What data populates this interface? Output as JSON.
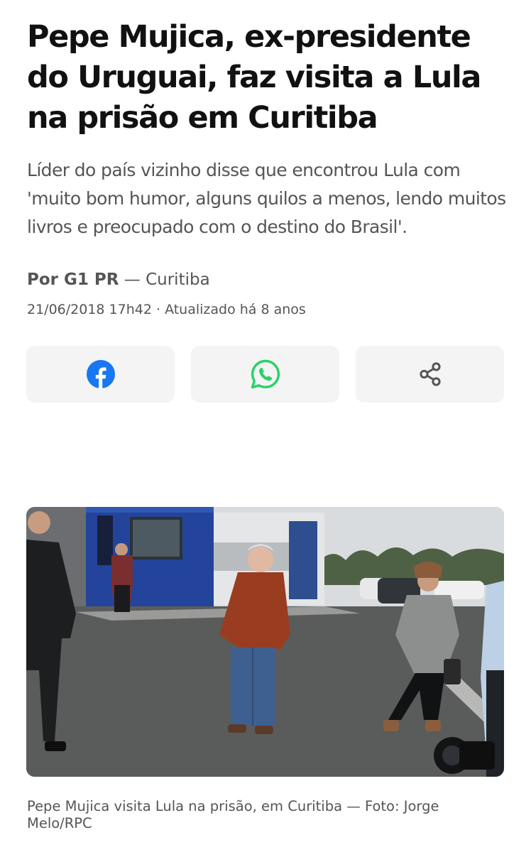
{
  "article": {
    "headline": "Pepe Mujica, ex-presidente do Uruguai, faz visita a Lula na prisão em Curitiba",
    "subtitle": "Líder do país vizinho disse que encontrou Lula com 'muito bom humor, alguns quilos a menos, lendo muitos livros e preocupado com o destino do Brasil'.",
    "byline": {
      "author": "Por G1 PR",
      "separator": "—",
      "location": "Curitiba"
    },
    "dateline": "21/06/2018 17h42 · Atualizado há 8 anos"
  },
  "share": {
    "buttons": [
      {
        "name": "facebook",
        "icon": "facebook-icon",
        "color": "#1877F2"
      },
      {
        "name": "whatsapp",
        "icon": "whatsapp-icon",
        "color": "#25D366"
      },
      {
        "name": "share",
        "icon": "share-icon",
        "color": "#555555"
      }
    ],
    "button_background": "#F4F4F4"
  },
  "media": {
    "caption": "Pepe Mujica visita Lula na prisão, em Curitiba — Foto: Jorge Melo/RPC"
  },
  "colors": {
    "text_primary": "#111111",
    "text_secondary": "#555555"
  }
}
